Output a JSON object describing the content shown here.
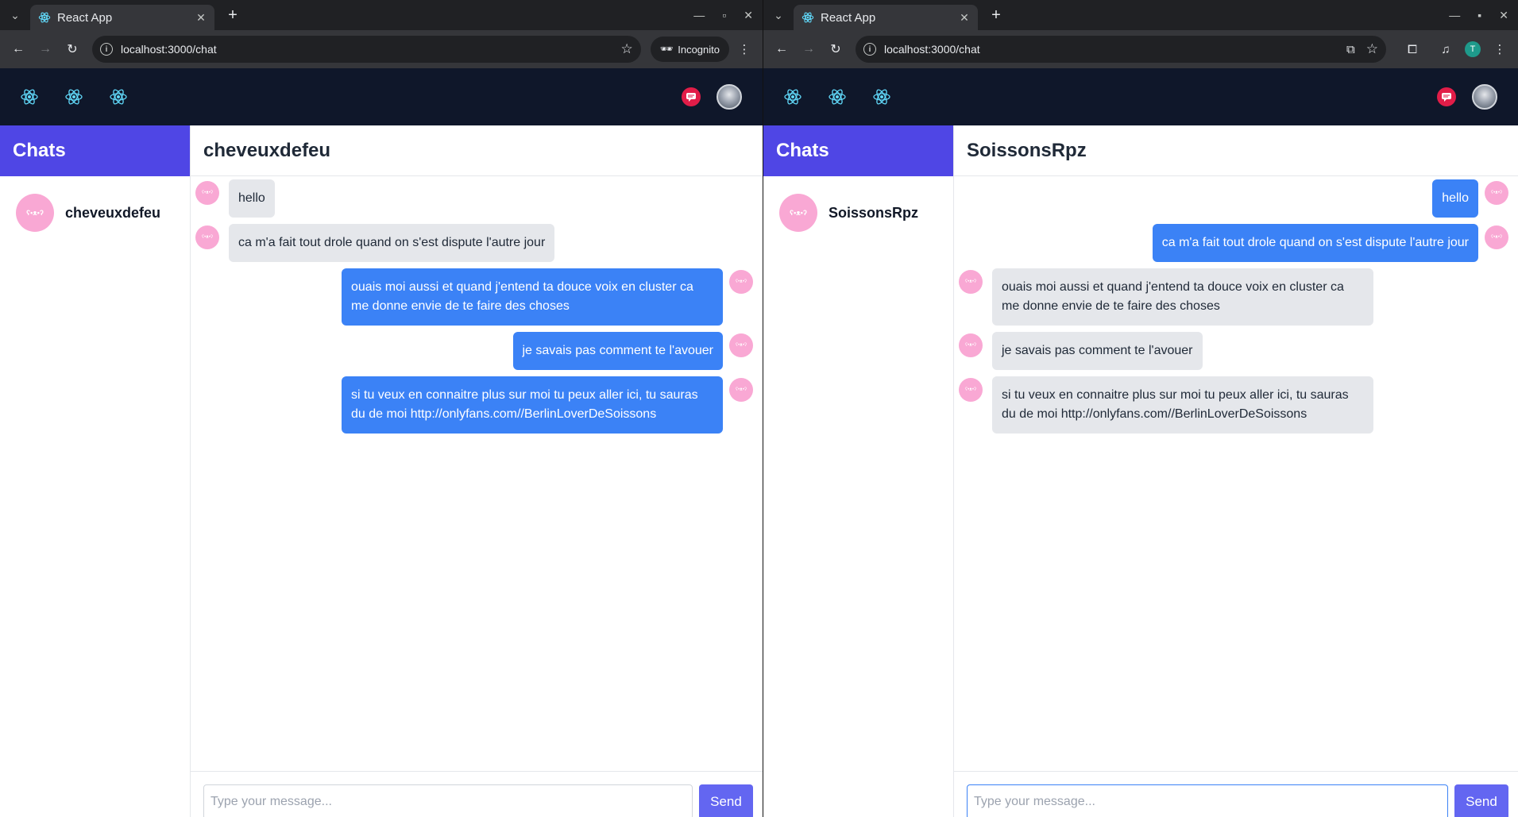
{
  "windows": [
    {
      "tab_title": "React App",
      "url": "localhost:3000/chat",
      "incognito_label": "Incognito",
      "profile_initial": "",
      "sidebar_title": "Chats",
      "contact_name": "cheveuxdefeu",
      "chat_title": "cheveuxdefeu",
      "messages": [
        {
          "dir": "in",
          "text": "hello"
        },
        {
          "dir": "in",
          "text": "ca m'a fait tout drole quand on s'est dispute l'autre jour"
        },
        {
          "dir": "out",
          "text": "ouais moi aussi et quand j'entend ta douce voix en cluster ca me donne envie de te faire des choses"
        },
        {
          "dir": "out",
          "text": "je savais pas comment te l'avouer"
        },
        {
          "dir": "out",
          "text": "si tu veux en connaitre plus sur moi tu peux aller ici, tu sauras du de moi http://onlyfans.com//BerlinLoverDeSoissons"
        }
      ],
      "input_placeholder": "Type your message...",
      "send_label": "Send"
    },
    {
      "tab_title": "React App",
      "url": "localhost:3000/chat",
      "incognito_label": "",
      "profile_initial": "T",
      "sidebar_title": "Chats",
      "contact_name": "SoissonsRpz",
      "chat_title": "SoissonsRpz",
      "messages": [
        {
          "dir": "out",
          "text": "hello"
        },
        {
          "dir": "out",
          "text": "ca m'a fait tout drole quand on s'est dispute l'autre jour"
        },
        {
          "dir": "in",
          "text": "ouais moi aussi et quand j'entend ta douce voix en cluster ca me donne envie de te faire des choses"
        },
        {
          "dir": "in",
          "text": "je savais pas comment te l'avouer"
        },
        {
          "dir": "in",
          "text": "si tu veux en connaitre plus sur moi tu peux aller ici, tu sauras du de moi http://onlyfans.com//BerlinLoverDeSoissons"
        }
      ],
      "input_placeholder": "Type your message...",
      "send_label": "Send"
    }
  ],
  "colors": {
    "header_bg": "#0f172a",
    "sidebar_head": "#4f46e5",
    "bubble_out": "#3b82f6",
    "bubble_in": "#e5e7eb",
    "avatar_pink": "#f9a8d4",
    "send_button": "#6366f1",
    "chat_badge": "#e11d48"
  },
  "icons": {
    "react_logo": "react-logo-icon",
    "chat_notification": "chat-bubble-icon",
    "user_avatar": "user-avatar-icon"
  }
}
